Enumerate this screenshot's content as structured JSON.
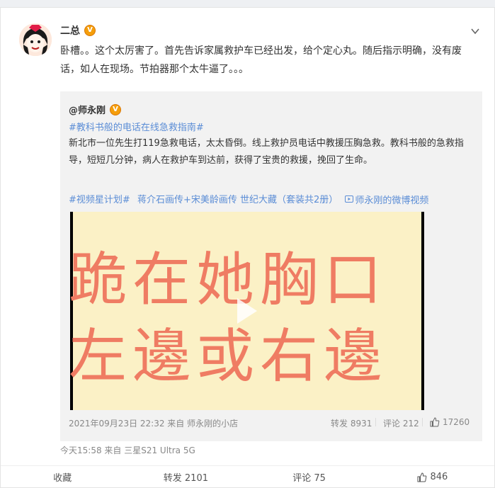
{
  "post": {
    "author": "二总",
    "verified_badge": "V",
    "text": "卧槽。。这个太厉害了。首先告诉家属救护车已经出发，给个定心丸。随后指示明确，没有废话，如人在现场。节拍器那个太牛逼了。。。",
    "meta": "今天15:58  来自 三星S21 Ultra 5G"
  },
  "repost": {
    "author": "@师永刚",
    "verified_badge": "V",
    "topic": "#教科书般的电话在线急救指南#",
    "text": "新北市一位先生打119急救电话，太太昏倒。线上救护员电话中教援压胸急救。教科书般的急救指导，短短几分钟，病人在救护车到达前，获得了宝贵的救援，挽回了生命。",
    "links": [
      "#视频星计划#",
      "蒋介石画传+宋美龄画传 世纪大藏（套装共2册）",
      "师永刚的微博视频"
    ],
    "video_caption": [
      "跪在她胸口",
      "左邊或右邊"
    ],
    "meta": "2021年09月23日 22:32 来自 师永刚的小店",
    "repost_count": "转发 8931",
    "comment_count": "评论 212",
    "like_count": "17260"
  },
  "footer": {
    "favorite": "收藏",
    "repost": "转发 2101",
    "comment": "评论 75",
    "like": "846"
  },
  "colors": {
    "link": "#5b8dd6",
    "badge": "#f59e0b",
    "video_text": "#ef7c63",
    "video_bg": "#fbf1c6"
  }
}
